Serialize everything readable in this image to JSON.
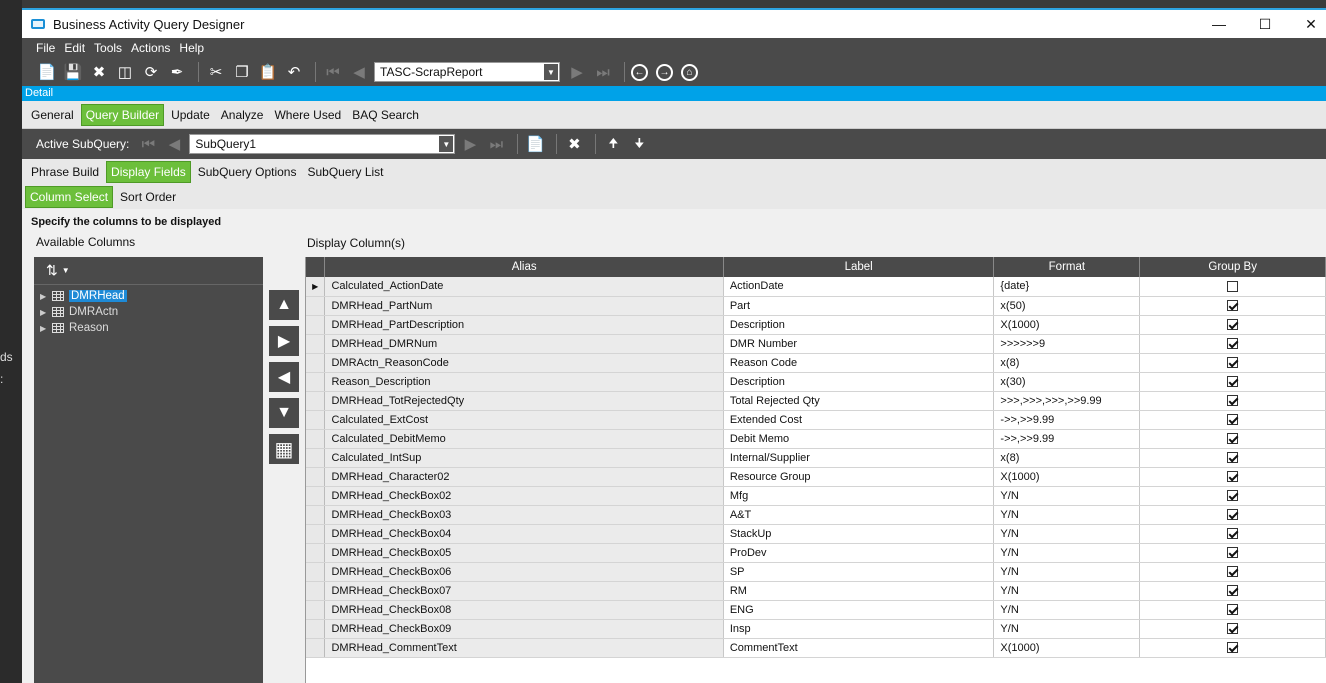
{
  "window": {
    "title": "Business Activity Query Designer"
  },
  "menu": [
    "File",
    "Edit",
    "Tools",
    "Actions",
    "Help"
  ],
  "toolbar": {
    "query_id": "TASC-ScrapReport"
  },
  "detail_label": "Detail",
  "main_tabs": [
    "General",
    "Query Builder",
    "Update",
    "Analyze",
    "Where Used",
    "BAQ Search"
  ],
  "subquery": {
    "label": "Active SubQuery:",
    "value": "SubQuery1"
  },
  "sub_tabs": [
    "Phrase Build",
    "Display Fields",
    "SubQuery Options",
    "SubQuery List"
  ],
  "field_tabs": [
    "Column Select",
    "Sort Order"
  ],
  "specify_text": "Specify the columns to be displayed",
  "available_columns_label": "Available Columns",
  "display_columns_label": "Display Column(s)",
  "tree_items": [
    "DMRHead",
    "DMRActn",
    "Reason"
  ],
  "grid": {
    "headers": [
      "Alias",
      "Label",
      "Format",
      "Group By"
    ],
    "rows": [
      {
        "alias": "Calculated_ActionDate",
        "label": "ActionDate",
        "format": "{date}",
        "group_by": false
      },
      {
        "alias": "DMRHead_PartNum",
        "label": "Part",
        "format": "x(50)",
        "group_by": true
      },
      {
        "alias": "DMRHead_PartDescription",
        "label": "Description",
        "format": "X(1000)",
        "group_by": true
      },
      {
        "alias": "DMRHead_DMRNum",
        "label": "DMR Number",
        "format": ">>>>>>9",
        "group_by": true
      },
      {
        "alias": "DMRActn_ReasonCode",
        "label": "Reason Code",
        "format": "x(8)",
        "group_by": true
      },
      {
        "alias": "Reason_Description",
        "label": "Description",
        "format": "x(30)",
        "group_by": true
      },
      {
        "alias": "DMRHead_TotRejectedQty",
        "label": "Total Rejected Qty",
        "format": ">>>,>>>,>>>,>>9.99",
        "group_by": true
      },
      {
        "alias": "Calculated_ExtCost",
        "label": "Extended Cost",
        "format": "->>,>>9.99",
        "group_by": true
      },
      {
        "alias": "Calculated_DebitMemo",
        "label": "Debit Memo",
        "format": "->>,>>9.99",
        "group_by": true
      },
      {
        "alias": "Calculated_IntSup",
        "label": "Internal/Supplier",
        "format": "x(8)",
        "group_by": true
      },
      {
        "alias": "DMRHead_Character02",
        "label": "Resource Group",
        "format": "X(1000)",
        "group_by": true
      },
      {
        "alias": "DMRHead_CheckBox02",
        "label": "Mfg",
        "format": "Y/N",
        "group_by": true
      },
      {
        "alias": "DMRHead_CheckBox03",
        "label": "A&T",
        "format": "Y/N",
        "group_by": true
      },
      {
        "alias": "DMRHead_CheckBox04",
        "label": "StackUp",
        "format": "Y/N",
        "group_by": true
      },
      {
        "alias": "DMRHead_CheckBox05",
        "label": "ProDev",
        "format": "Y/N",
        "group_by": true
      },
      {
        "alias": "DMRHead_CheckBox06",
        "label": "SP",
        "format": "Y/N",
        "group_by": true
      },
      {
        "alias": "DMRHead_CheckBox07",
        "label": "RM",
        "format": "Y/N",
        "group_by": true
      },
      {
        "alias": "DMRHead_CheckBox08",
        "label": "ENG",
        "format": "Y/N",
        "group_by": true
      },
      {
        "alias": "DMRHead_CheckBox09",
        "label": "Insp",
        "format": "Y/N",
        "group_by": true
      },
      {
        "alias": "DMRHead_CommentText",
        "label": "CommentText",
        "format": "X(1000)",
        "group_by": true
      }
    ]
  },
  "background_fragments": [
    "ds",
    ":"
  ]
}
